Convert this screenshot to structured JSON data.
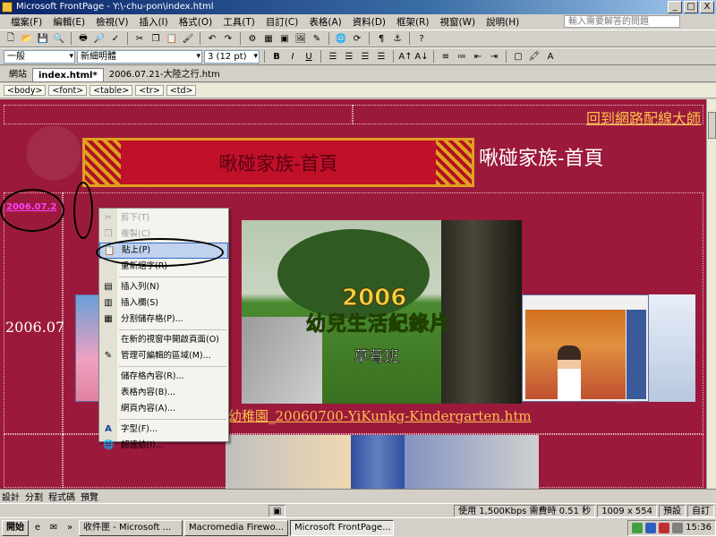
{
  "window": {
    "title": "Microsoft FrontPage - Y:\\-chu-pon\\index.html",
    "buttons": [
      "_",
      "□",
      "X"
    ]
  },
  "menu": {
    "items": [
      "檔案(F)",
      "編輯(E)",
      "檢視(V)",
      "插入(I)",
      "格式(O)",
      "工具(T)",
      "目訂(C)",
      "表格(A)",
      "資料(D)",
      "框架(R)",
      "視窗(W)",
      "說明(H)"
    ],
    "help_placeholder": "輸入需要解答的問題"
  },
  "toolbar": {
    "style_value": "一般",
    "font_value": "新細明體",
    "size_value": "3  (12 pt)",
    "bold": "B",
    "italic": "I",
    "underline": "U"
  },
  "tabs": {
    "site": "網站",
    "active": "index.html*",
    "other": "2006.07.21-大陸之行.htm"
  },
  "tagbar": [
    "<body>",
    "<font>",
    "<table>",
    "<tr>",
    "<td>"
  ],
  "page": {
    "top_link": "回到網路配線大師",
    "banner_text": "啾碰家族-首頁",
    "heading": "啾碰家族-首頁",
    "date_link": "2006.07.2",
    "side_date": "2006.07",
    "video_year": "2006",
    "video_title": "幼兒生活紀錄片",
    "video_class": "草莓班",
    "file_link": "幼稚園_20060700-YiKunkg-Kindergarten.htm"
  },
  "context_menu": {
    "items": [
      {
        "label": "剪下(T)",
        "icon": "scissors-icon",
        "glyph": "✂",
        "disabled": true
      },
      {
        "label": "複製(C)",
        "icon": "copy-icon",
        "glyph": "❐",
        "disabled": true
      },
      {
        "label": "貼上(P)",
        "icon": "paste-icon",
        "glyph": "📋",
        "highlighted": true
      },
      {
        "label": "重新組字(R)",
        "icon": "",
        "glyph": ""
      },
      {
        "label": "插入列(N)",
        "icon": "insert-row-icon",
        "glyph": "▤",
        "sep_before": true
      },
      {
        "label": "插入欄(S)",
        "icon": "insert-column-icon",
        "glyph": "▥"
      },
      {
        "label": "分割儲存格(P)...",
        "icon": "split-cell-icon",
        "glyph": "▦"
      },
      {
        "label": "在新的視窗中開啟頁面(O)",
        "icon": "",
        "glyph": "",
        "sep_before": true
      },
      {
        "label": "管理可編輯的區域(M)...",
        "icon": "editable-region-icon",
        "glyph": "✎"
      },
      {
        "label": "儲存格內容(R)...",
        "icon": "",
        "glyph": "",
        "sep_before": true
      },
      {
        "label": "表格內容(B)...",
        "icon": "",
        "glyph": ""
      },
      {
        "label": "網頁內容(A)...",
        "icon": "",
        "glyph": ""
      },
      {
        "label": "字型(F)...",
        "icon": "font-icon",
        "glyph": "A",
        "sep_before": true
      },
      {
        "label": "超連結(I)...",
        "icon": "hyperlink-icon",
        "glyph": "🌐"
      }
    ]
  },
  "view_tabs": [
    "設計",
    "分割",
    "程式碼",
    "預覽"
  ],
  "status": {
    "speed": "使用 1,500Kbps 需費時 0.51 秒",
    "dimensions": "1009 x 554",
    "mode": "預設",
    "custom": "自訂"
  },
  "taskbar": {
    "start": "開始",
    "tasks": [
      "收件匣 - Microsoft ...",
      "Macromedia Firewo...",
      "Microsoft FrontPage..."
    ],
    "clock": "15:36"
  },
  "colors": {
    "page_bg": "#9b1a3c",
    "link": "#ffc04a",
    "date_link": "#ff40ff"
  }
}
